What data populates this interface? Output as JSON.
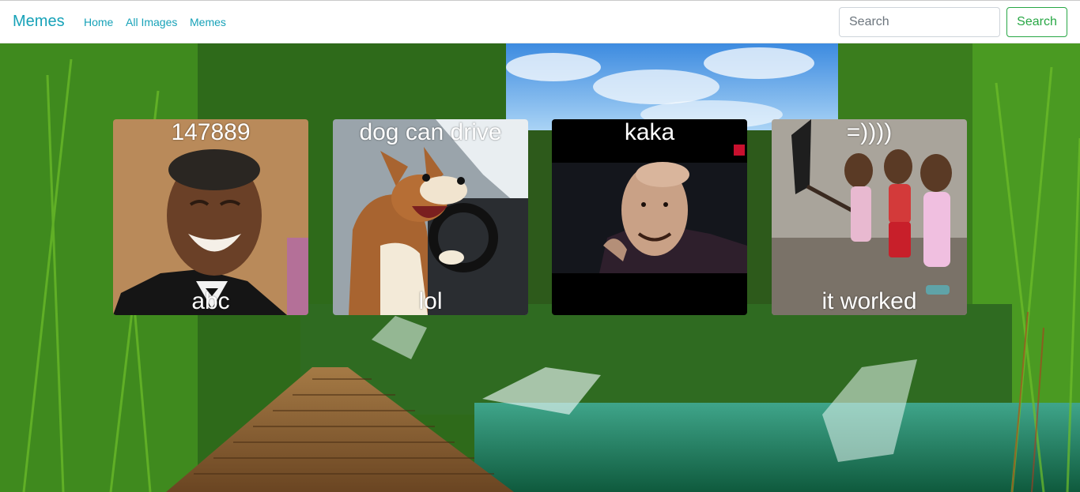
{
  "nav": {
    "brand": "Memes",
    "links": [
      "Home",
      "All Images",
      "Memes"
    ],
    "search_placeholder": "Search",
    "search_button": "Search"
  },
  "memes": [
    {
      "top": "147889",
      "bottom": "abc"
    },
    {
      "top": "dog can drive",
      "bottom": "lol"
    },
    {
      "top": "kaka",
      "bottom": ""
    },
    {
      "top": "=))))",
      "bottom": "it worked"
    }
  ],
  "colors": {
    "link": "#17a2b8",
    "search_button": "#28a745"
  }
}
